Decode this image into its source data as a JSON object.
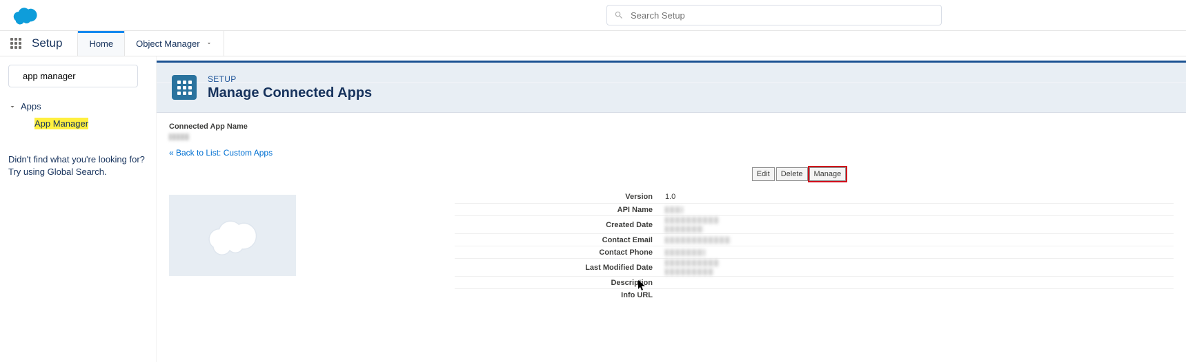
{
  "globalSearch": {
    "placeholder": "Search Setup"
  },
  "nav": {
    "title": "Setup",
    "tabs": {
      "home": "Home",
      "objectManager": "Object Manager"
    }
  },
  "sidebar": {
    "quickFindValue": "app manager",
    "tree": {
      "apps": "Apps",
      "appManager": "App Manager"
    },
    "hintL1": "Didn't find what you're looking for?",
    "hintL2": "Try using Global Search."
  },
  "pageHeader": {
    "eyebrow": "SETUP",
    "title": "Manage Connected Apps"
  },
  "detail": {
    "nameLabel": "Connected App Name",
    "backLink": "« Back to List: Custom Apps",
    "buttons": {
      "edit": "Edit",
      "delete": "Delete",
      "manage": "Manage"
    },
    "fields": {
      "version": {
        "label": "Version",
        "value": "1.0"
      },
      "apiName": {
        "label": "API Name"
      },
      "createdDate": {
        "label": "Created Date"
      },
      "contactEmail": {
        "label": "Contact Email"
      },
      "contactPhone": {
        "label": "Contact Phone"
      },
      "lastModifiedDate": {
        "label": "Last Modified Date"
      },
      "description": {
        "label": "Description"
      },
      "infoUrl": {
        "label": "Info URL"
      }
    }
  }
}
